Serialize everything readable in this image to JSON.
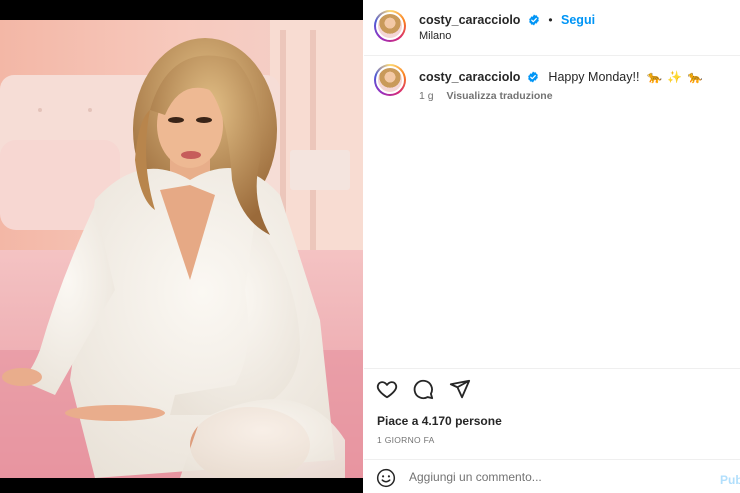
{
  "post": {
    "author": {
      "username": "costy_caracciolo",
      "verified": true,
      "location": "Milano"
    },
    "follow_label": "Segui",
    "separator": "•",
    "caption": {
      "username": "costy_caracciolo",
      "text": "Happy Monday!!",
      "emojis": "🐆 ✨ 🐆"
    },
    "time_ago": "1 g",
    "translate_label": "Visualizza traduzione",
    "likes_text": "Piace a 4.170 persone",
    "date_text": "1 GIORNO FA",
    "comment": {
      "placeholder": "Aggiungi un commento...",
      "publish_label": "Pubblica"
    }
  },
  "icons": {
    "like": "heart-icon",
    "comment": "comment-bubble-icon",
    "share": "paper-plane-icon",
    "emoji": "smiley-face-icon",
    "verified": "verified-badge-icon"
  },
  "colors": {
    "accent": "#0095f6",
    "text": "#262626",
    "secondary": "#737373",
    "publish_disabled": "#b2dffc"
  }
}
